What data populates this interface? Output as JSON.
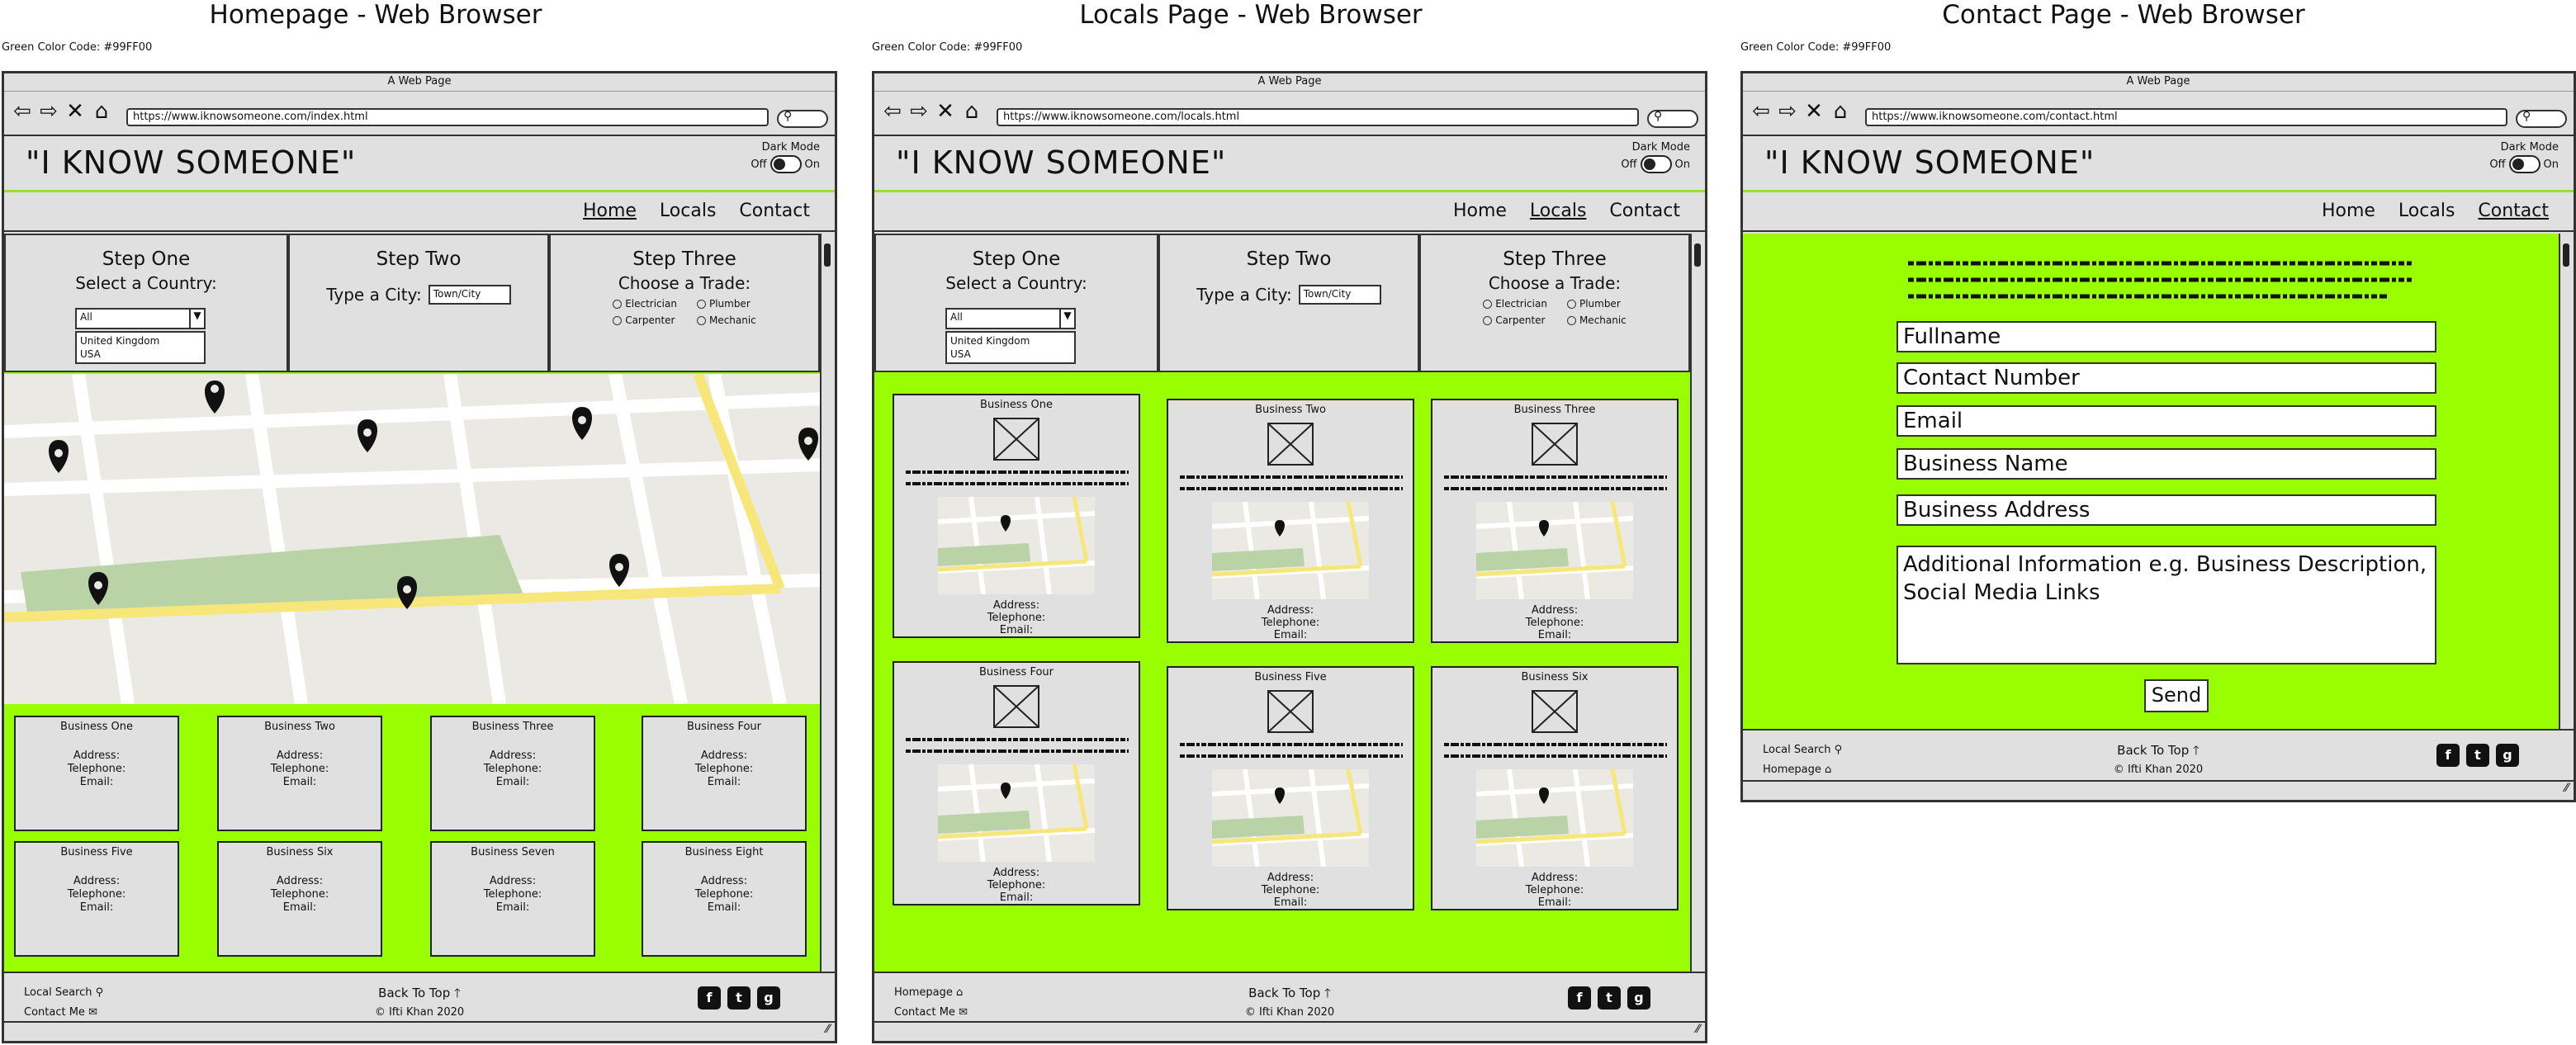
{
  "panels": [
    {
      "title": "Homepage - Web Browser",
      "green_note": "Green Color Code: #99FF00",
      "window_title": "A Web Page",
      "url": "https://www.iknowsomeone.com/index.html",
      "nav_active": "Home"
    },
    {
      "title": "Locals Page - Web Browser",
      "green_note": "Green Color Code: #99FF00",
      "window_title": "A Web Page",
      "url": "https://www.iknowsomeone.com/locals.html",
      "nav_active": "Locals"
    },
    {
      "title": "Contact Page - Web Browser",
      "green_note": "Green Color Code: #99FF00",
      "window_title": "A Web Page",
      "url": "https://www.iknowsomeone.com/contact.html",
      "nav_active": "Contact"
    }
  ],
  "site": {
    "logo": "\"I KNOW SOMEONE\"",
    "dark_mode_label": "Dark Mode",
    "toggle_off": "Off",
    "toggle_on": "On",
    "nav": [
      "Home",
      "Locals",
      "Contact"
    ]
  },
  "steps": {
    "one_title": "Step One",
    "one_label": "Select a Country:",
    "country_selected": "All",
    "country_options": [
      "United Kingdom",
      "USA"
    ],
    "two_title": "Step Two",
    "two_label": "Type a City:",
    "city_placeholder": "Town/City",
    "three_title": "Step Three",
    "three_label": "Choose a Trade:",
    "trades": [
      "Electrician",
      "Plumber",
      "Carpenter",
      "Mechanic"
    ]
  },
  "business_fields": {
    "address": "Address:",
    "telephone": "Telephone:",
    "email": "Email:"
  },
  "home_businesses": [
    "Business One",
    "Business Two",
    "Business Three",
    "Business Four",
    "Business Five",
    "Business Six",
    "Business Seven",
    "Business Eight"
  ],
  "locals_businesses": [
    "Business One",
    "Business Two",
    "Business Three",
    "Business Four",
    "Business Five",
    "Business Six"
  ],
  "contact_form": {
    "fields": [
      "Fullname",
      "Contact Number",
      "Email",
      "Business Name",
      "Business Address"
    ],
    "textarea": "Additional Information e.g. Business Description, Social Media Links",
    "send": "Send"
  },
  "footer": {
    "local_search": "Local Search",
    "contact_me": "Contact Me",
    "homepage": "Homepage",
    "back_to_top": "Back To Top",
    "copyright": "© Ifti Khan 2020",
    "social": [
      "f",
      "t",
      "g"
    ]
  },
  "colors": {
    "accent_green": "#99FF00",
    "panel_grey": "#E0E0E0"
  },
  "icons": [
    "back-arrow-icon",
    "forward-arrow-icon",
    "close-icon",
    "home-icon",
    "search-icon",
    "envelope-icon",
    "arrow-up-icon",
    "facebook-icon",
    "twitter-icon",
    "github-icon",
    "map-pin-icon",
    "image-placeholder-icon"
  ]
}
